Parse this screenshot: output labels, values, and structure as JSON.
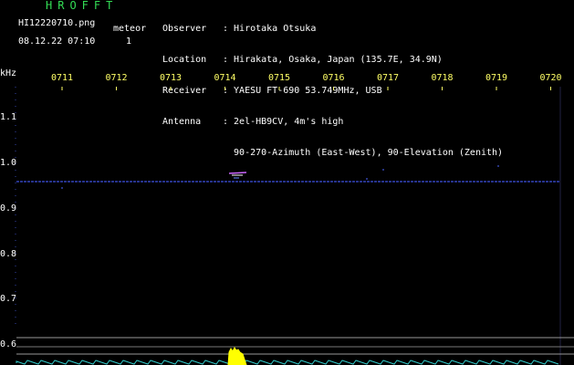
{
  "header": {
    "title": "HROFFT",
    "filename": "HI12220710.png",
    "datetime": "08.12.22 07:10",
    "meteor_label": "meteor",
    "meteor_count": "1"
  },
  "info": [
    {
      "key": "Observer",
      "value": ": Hirotaka Otsuka"
    },
    {
      "key": "Location",
      "value": ": Hirakata, Osaka, Japan (135.7E, 34.9N)"
    },
    {
      "key": "Receiver",
      "value": ": YAESU FT-690 53.749MHz, USB"
    },
    {
      "key": "Antenna",
      "value": ": 2el-HB9CV, 4m's high"
    },
    {
      "key": "",
      "value": "  90-270-Azimuth (East-West), 90-Elevation (Zenith)"
    }
  ],
  "axis": {
    "unit": "kHz",
    "time_labels": [
      "0711",
      "0712",
      "0713",
      "0714",
      "0715",
      "0716",
      "0717",
      "0718",
      "0719",
      "0720"
    ],
    "freq_labels": [
      "1.1",
      "1.0",
      "0.9",
      "0.8",
      "0.7",
      "0.6"
    ]
  },
  "colors": {
    "text_green": "#33dd55",
    "text_white": "#ffffff",
    "time_yellow": "#ffff66",
    "signal_line": "#3344bb",
    "meteor": "#ffff00"
  },
  "chart_data": {
    "type": "heatmap",
    "x_labels": [
      "0711",
      "0712",
      "0713",
      "0714",
      "0715",
      "0716",
      "0717",
      "0718",
      "0719",
      "0720"
    ],
    "y_unit": "kHz",
    "y_ticks": [
      1.1,
      1.0,
      0.9,
      0.8,
      0.7,
      0.6
    ],
    "carrier_khz": 0.96,
    "meteor_echo": {
      "time": "0714",
      "freq_khz": 0.97
    }
  }
}
